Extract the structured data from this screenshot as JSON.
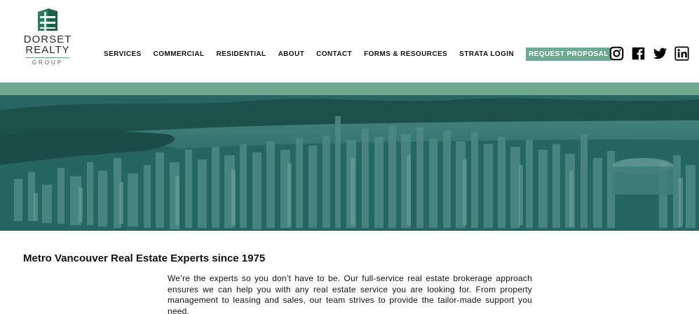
{
  "brand": {
    "name_line1": "DORSET",
    "name_line2": "REALTY",
    "name_line3": "GROUP",
    "primary_color": "#6fa891",
    "dark_green": "#1f6b52"
  },
  "nav": {
    "items": [
      {
        "label": "SERVICES"
      },
      {
        "label": "COMMERCIAL"
      },
      {
        "label": "RESIDENTIAL"
      },
      {
        "label": "ABOUT"
      },
      {
        "label": "CONTACT"
      },
      {
        "label": "FORMS & RESOURCES"
      },
      {
        "label": "STRATA LOGIN"
      }
    ],
    "cta_label": "REQUEST PROPOSAL"
  },
  "social": {
    "icons": [
      "instagram-icon",
      "facebook-icon",
      "twitter-icon",
      "linkedin-icon"
    ]
  },
  "hero": {
    "image_subject": "aerial city skyline",
    "overlay_color": "#1d5c57"
  },
  "main": {
    "headline": "Metro Vancouver Real Estate Experts since 1975",
    "intro": "We’re the experts so you don’t have to be. Our full-service real estate brokerage approach ensures we can help you with any real estate service you are looking for. From property management to leasing and sales, our team strives to provide the tailor-made support you need."
  }
}
